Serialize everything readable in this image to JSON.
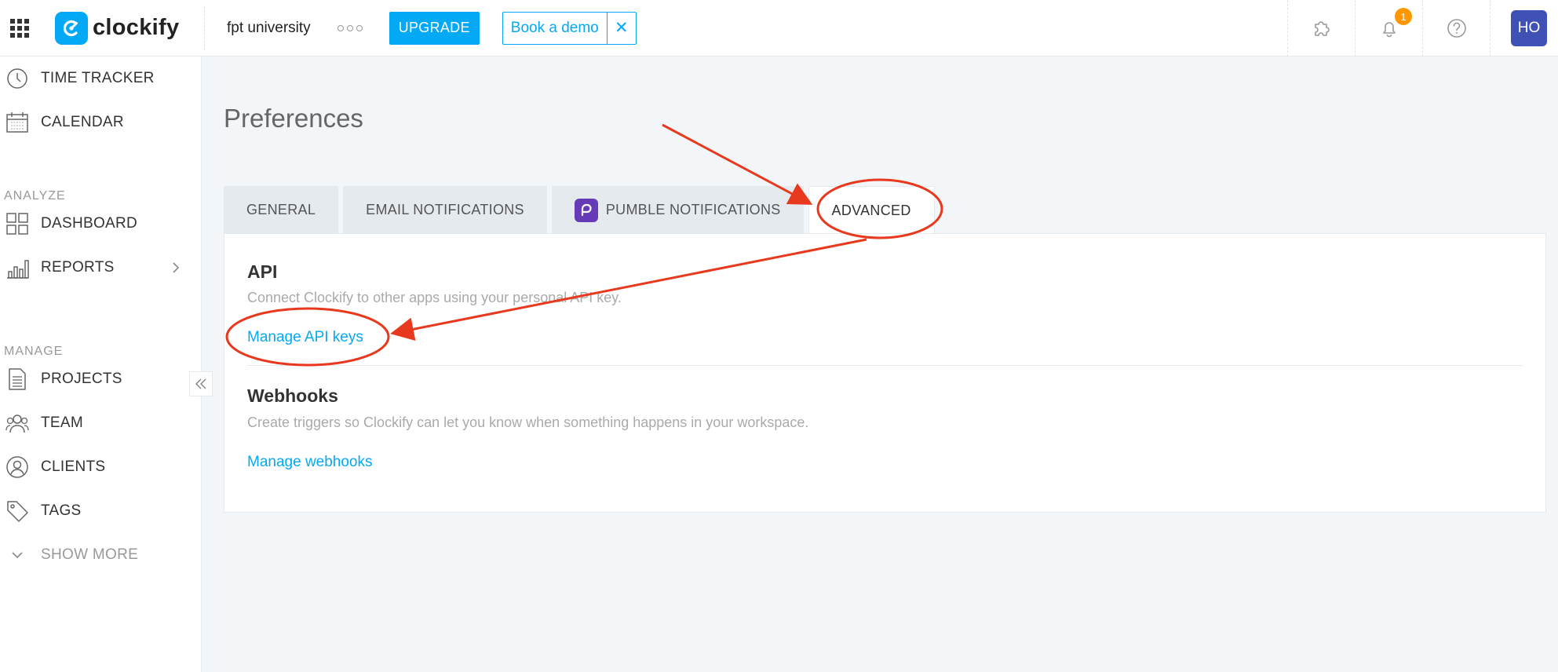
{
  "header": {
    "logo_text": "clockify",
    "workspace": "fpt university",
    "upgrade_label": "UPGRADE",
    "demo_label": "Book a demo",
    "demo_close": "✕",
    "notification_count": "1",
    "avatar_initials": "HO"
  },
  "sidebar": {
    "items_top": [
      {
        "label": "TIME TRACKER",
        "icon": "clock-icon"
      },
      {
        "label": "CALENDAR",
        "icon": "calendar-icon"
      }
    ],
    "section_analyze": "ANALYZE",
    "items_analyze": [
      {
        "label": "DASHBOARD",
        "icon": "dashboard-icon"
      },
      {
        "label": "REPORTS",
        "icon": "reports-icon"
      }
    ],
    "section_manage": "MANAGE",
    "items_manage": [
      {
        "label": "PROJECTS",
        "icon": "projects-icon"
      },
      {
        "label": "TEAM",
        "icon": "team-icon"
      },
      {
        "label": "CLIENTS",
        "icon": "clients-icon"
      },
      {
        "label": "TAGS",
        "icon": "tag-icon"
      }
    ],
    "show_more": "SHOW MORE"
  },
  "main": {
    "title": "Preferences",
    "tabs": [
      {
        "label": "GENERAL"
      },
      {
        "label": "EMAIL NOTIFICATIONS"
      },
      {
        "label": "PUMBLE NOTIFICATIONS"
      },
      {
        "label": "ADVANCED"
      }
    ],
    "api": {
      "title": "API",
      "description": "Connect Clockify to other apps using your personal API key.",
      "link": "Manage API keys"
    },
    "webhooks": {
      "title": "Webhooks",
      "description": "Create triggers so Clockify can let you know when something happens in your workspace.",
      "link": "Manage webhooks"
    }
  },
  "colors": {
    "brand": "#03a9f4",
    "annotation": "#e8391e",
    "avatar": "#3f51b5",
    "badge": "#ff9800",
    "pumble": "#673ab7"
  }
}
